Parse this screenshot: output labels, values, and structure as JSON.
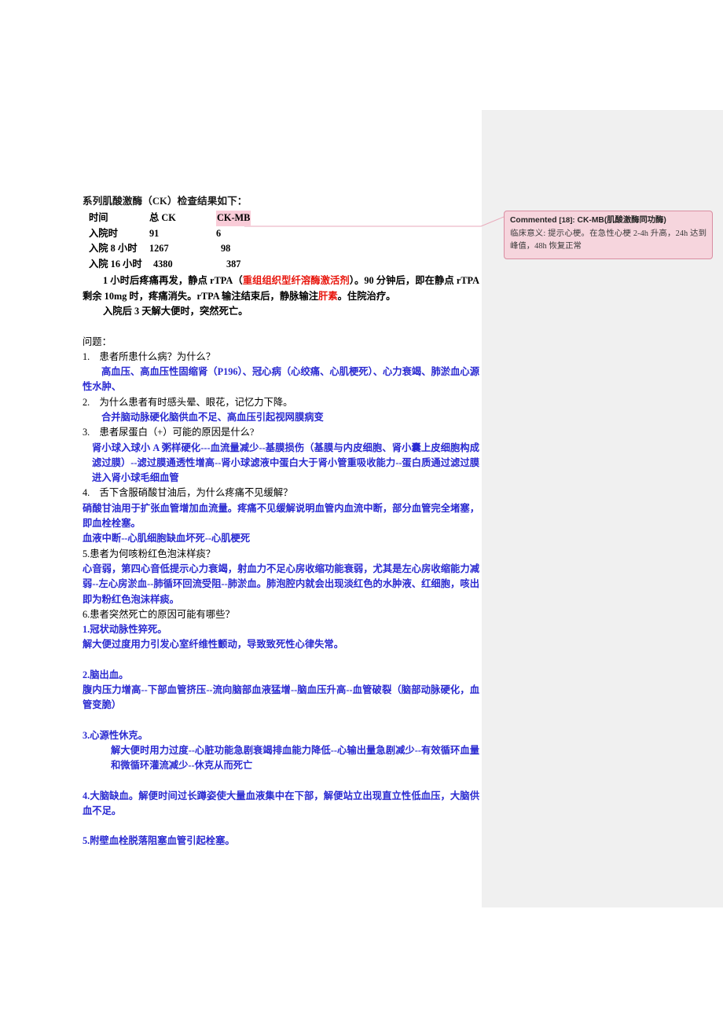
{
  "document": {
    "heading": "系列肌酸激酶（CK）检查结果如下：",
    "table": {
      "columns": [
        "时间",
        "总 CK",
        "CK-MB"
      ],
      "highlighted_column": "CK-MB",
      "rows": [
        {
          "time": "入院时",
          "total_ck": "91",
          "ck_mb": "6"
        },
        {
          "time": "入院 8 小时",
          "total_ck": "1267",
          "ck_mb": "98"
        },
        {
          "time": "入院 16 小时",
          "total_ck": "4380",
          "ck_mb": "387"
        }
      ]
    },
    "narrative": {
      "p1_before_red": "1 小时后疼痛再发，静点 rTPA（",
      "p1_red1": "重组组织型纤溶酶激活剂",
      "p1_middle": "）。90 分钟后，即在静点 rTPA 剩余 10mg 时，疼痛消失。rTPA 输注结束后，静脉输注",
      "p1_red2": "肝素",
      "p1_after": "。住院治疗。",
      "p2": "入院后 3 天解大便时，突然死亡。"
    },
    "questions_label": "问题：",
    "qa": [
      {
        "question": "1.　患者所患什么病？为什么？",
        "answers": [
          "高血压、高血压性固缩肾（P196）、冠心病（心绞痛、心肌梗死）、心力衰竭、肺淤血心源性水肿、"
        ]
      },
      {
        "question": "2.　为什么患者有时感头晕、眼花，记忆力下降。",
        "answers": [
          "合并脑动脉硬化脑供血不足、高血压引起视网膜病变"
        ]
      },
      {
        "question": "3.　患者尿蛋白（+）可能的原因是什么?",
        "answers": [
          "肾小球入球小 A 粥样硬化---血流量减少--基膜损伤（基膜与内皮细胞、肾小囊上皮细胞构成滤过膜）--滤过膜通透性增高--肾小球滤液中蛋白大于肾小管重吸收能力--蛋白质通过滤过膜进入肾小球毛细血管"
        ]
      },
      {
        "question": "4.　舌下含服硝酸甘油后，为什么疼痛不见缓解？",
        "answers": [
          "硝酸甘油用于扩张血管增加血流量。疼痛不见缓解说明血管内血流中断，部分血管完全堵塞，即血栓栓塞。",
          "血液中断--心肌细胞缺血坏死--心肌梗死"
        ]
      },
      {
        "question": "5.患者为何咳粉红色泡沫样痰？",
        "answers": [
          "心音弱，第四心音低提示心力衰竭，射血力不足心房收缩功能衰弱，尤其是左心房收缩能力减弱--左心房淤血--肺循环回流受阻--肺淤血。肺泡腔内就会出现淡红色的水肿液、红细胞，咳出即为粉红色泡沫样痰。"
        ]
      },
      {
        "question": "6.患者突然死亡的原因可能有哪些？",
        "answers": []
      }
    ],
    "death_causes": [
      {
        "title": "1.冠状动脉性猝死。",
        "detail": "解大便过度用力引发心室纤维性颤动，导致致死性心律失常。",
        "detail_indent": "none"
      },
      {
        "title": "2.脑出血。",
        "detail": "腹内压力增高--下部血管挤压--流向脑部血液猛增--脑血压升高--血管破裂（脑部动脉硬化，血管变脆）",
        "detail_indent": "none"
      },
      {
        "title": "3.心源性休克。",
        "detail": "解大便时用力过度--心脏功能急剧衰竭排血能力降低--心输出量急剧减少--有效循环血量和微循环灌流减少--休克从而死亡",
        "detail_indent": "deep"
      },
      {
        "title": "4.大脑缺血。解便时间过长蹲姿使大量血液集中在下部，解便站立出现直立性低血压，大脑供血不足。",
        "detail": "",
        "detail_indent": "none"
      },
      {
        "title": "5.附壁血栓脱落阻塞血管引起栓塞。",
        "detail": "",
        "detail_indent": "none"
      }
    ]
  },
  "comment": {
    "label": "Commented",
    "ref": "[18]:",
    "subject": "CK-MB(肌酸激酶同功酶)",
    "body": "临床意义: 提示心梗。在急性心梗 2-4h 升高，24h 达到峰值，48h 恢复正常"
  },
  "colors": {
    "highlight": "#f9ccd8",
    "comment_bg": "#f6d5dd",
    "comment_border": "#d98da1",
    "answer_blue": "#2a2ad1",
    "emphasis_red": "#e8170e",
    "gutter_gray": "#f0f0f0"
  }
}
